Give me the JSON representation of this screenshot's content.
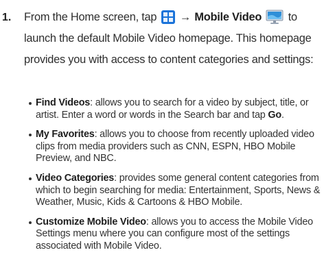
{
  "step": {
    "number": "1.",
    "intro": "From the Home screen, tap",
    "arrow": "→",
    "app_name": "Mobile Video",
    "rest": "to launch the default Mobile Video homepage. This homepage provides you with access to content categories and settings:",
    "icons": [
      "apps-grid-icon",
      "mobile-video-monitor-icon"
    ],
    "colors": {
      "apps_icon_blue": "#1a73d9",
      "monitor_blue": "#2f8fd8"
    }
  },
  "bullets": [
    {
      "term": "Find Videos",
      "text": ": allows you to search for a video by subject, title, or artist. Enter a word or words in the Search bar and tap ",
      "emph": "Go",
      "tail": "."
    },
    {
      "term": "My Favorites",
      "text": ": allows you to choose from recently uploaded video clips from media providers such as CNN, ESPN, HBO Mobile Preview, and NBC.",
      "emph": "",
      "tail": ""
    },
    {
      "term": "Video Categories",
      "text": ": provides some general content categories from which to begin searching for media: Entertainment, Sports, News & Weather, Music, Kids & Cartoons & HBO Mobile.",
      "emph": "",
      "tail": ""
    },
    {
      "term": "Customize Mobile Video",
      "text": ": allows you to access the Mobile Video Settings menu where you can configure most of the settings associated with Mobile Video.",
      "emph": "",
      "tail": ""
    }
  ]
}
